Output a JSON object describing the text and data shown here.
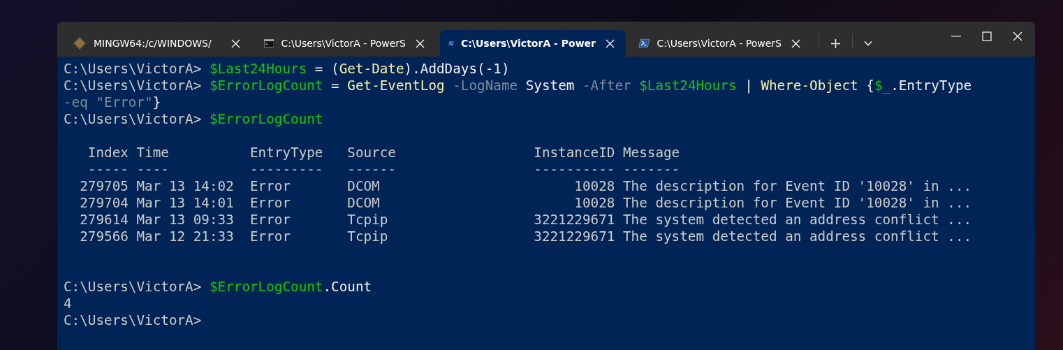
{
  "tabs": [
    {
      "kind": "git",
      "label": "MINGW64:/c/WINDOWS/",
      "selected": false
    },
    {
      "kind": "cmd",
      "label": "C:\\Users\\VictorA - PowerS",
      "selected": false
    },
    {
      "kind": "powershell",
      "label": "C:\\Users\\VictorA - Power",
      "selected": true
    },
    {
      "kind": "powershell",
      "label": "C:\\Users\\VictorA - PowerS",
      "selected": false
    }
  ],
  "terminal": {
    "lines": [
      {
        "kind": "text",
        "segments": [
          {
            "kind": "prompt",
            "text": "C:\\Users\\VictorA> "
          },
          {
            "kind": "variable",
            "text": "$Last24Hours"
          },
          {
            "kind": "plain",
            "text": " = ("
          },
          {
            "kind": "command",
            "text": "Get-Date"
          },
          {
            "kind": "plain",
            "text": ").AddDays(-1)"
          }
        ]
      },
      {
        "kind": "text",
        "segments": [
          {
            "kind": "prompt",
            "text": "C:\\Users\\VictorA> "
          },
          {
            "kind": "variable",
            "text": "$ErrorLogCount"
          },
          {
            "kind": "plain",
            "text": " = "
          },
          {
            "kind": "command",
            "text": "Get-EventLog"
          },
          {
            "kind": "parameter",
            "text": " -LogName"
          },
          {
            "kind": "plain",
            "text": " System "
          },
          {
            "kind": "parameter",
            "text": "-After "
          },
          {
            "kind": "variable",
            "text": "$Last24Hours"
          },
          {
            "kind": "plain",
            "text": " | "
          },
          {
            "kind": "command",
            "text": "Where-Object"
          },
          {
            "kind": "plain",
            "text": " {"
          },
          {
            "kind": "variable",
            "text": "$_"
          },
          {
            "kind": "plain",
            "text": ".EntryType"
          }
        ]
      },
      {
        "kind": "text",
        "segments": [
          {
            "kind": "parameter",
            "text": "-eq \"Error\""
          },
          {
            "kind": "plain",
            "text": "}"
          }
        ]
      },
      {
        "kind": "text",
        "segments": [
          {
            "kind": "prompt",
            "text": "C:\\Users\\VictorA> "
          },
          {
            "kind": "variable",
            "text": "$ErrorLogCount"
          }
        ]
      },
      {
        "kind": "blank"
      },
      {
        "kind": "text",
        "segments": [
          {
            "kind": "output",
            "text": "   Index Time          EntryType   Source                 InstanceID Message"
          }
        ]
      },
      {
        "kind": "text",
        "segments": [
          {
            "kind": "output",
            "text": "   ----- ----          ---------   ------                 ---------- -------"
          }
        ]
      },
      {
        "kind": "text",
        "segments": [
          {
            "kind": "output",
            "text": "  279705 Mar 13 14:02  Error       DCOM                        10028 The description for Event ID '10028' in ..."
          }
        ]
      },
      {
        "kind": "text",
        "segments": [
          {
            "kind": "output",
            "text": "  279704 Mar 13 14:01  Error       DCOM                        10028 The description for Event ID '10028' in ..."
          }
        ]
      },
      {
        "kind": "text",
        "segments": [
          {
            "kind": "output",
            "text": "  279614 Mar 13 09:33  Error       Tcpip                  3221229671 The system detected an address conflict ..."
          }
        ]
      },
      {
        "kind": "text",
        "segments": [
          {
            "kind": "output",
            "text": "  279566 Mar 12 21:33  Error       Tcpip                  3221229671 The system detected an address conflict ..."
          }
        ]
      },
      {
        "kind": "blank"
      },
      {
        "kind": "blank"
      },
      {
        "kind": "text",
        "segments": [
          {
            "kind": "prompt",
            "text": "C:\\Users\\VictorA> "
          },
          {
            "kind": "variable",
            "text": "$ErrorLogCount"
          },
          {
            "kind": "plain",
            "text": ".Count"
          }
        ]
      },
      {
        "kind": "text",
        "segments": [
          {
            "kind": "output",
            "text": "4"
          }
        ]
      },
      {
        "kind": "text",
        "segments": [
          {
            "kind": "prompt",
            "text": "C:\\Users\\VictorA>"
          }
        ]
      }
    ]
  }
}
